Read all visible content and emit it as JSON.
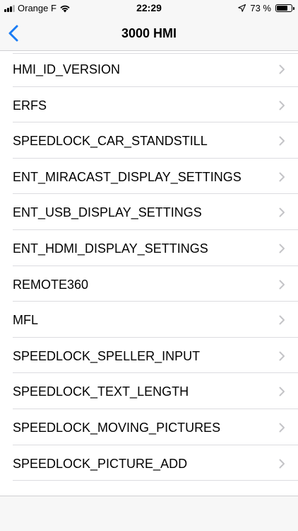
{
  "status_bar": {
    "carrier": "Orange F",
    "time": "22:29",
    "battery_percent": "73 %",
    "battery_level": 0.73,
    "signal_bars_active": 3,
    "signal_bars_total": 4
  },
  "nav": {
    "title": "3000 HMI",
    "back_icon": "chevron-left-icon"
  },
  "list": {
    "items": [
      {
        "label": "HMI_ID_VERSION"
      },
      {
        "label": "ERFS"
      },
      {
        "label": "SPEEDLOCK_CAR_STANDSTILL"
      },
      {
        "label": "ENT_MIRACAST_DISPLAY_SETTINGS"
      },
      {
        "label": "ENT_USB_DISPLAY_SETTINGS"
      },
      {
        "label": "ENT_HDMI_DISPLAY_SETTINGS"
      },
      {
        "label": "REMOTE360"
      },
      {
        "label": "MFL"
      },
      {
        "label": "SPEEDLOCK_SPELLER_INPUT"
      },
      {
        "label": "SPEEDLOCK_TEXT_LENGTH"
      },
      {
        "label": "SPEEDLOCK_MOVING_PICTURES"
      },
      {
        "label": "SPEEDLOCK_PICTURE_ADD"
      }
    ],
    "chevron_icon": "chevron-right-icon"
  },
  "colors": {
    "accent": "#1a7cf5",
    "chevron": "#c4c4c7",
    "separator": "#dcdce0",
    "bar_background": "#f7f7f7"
  }
}
